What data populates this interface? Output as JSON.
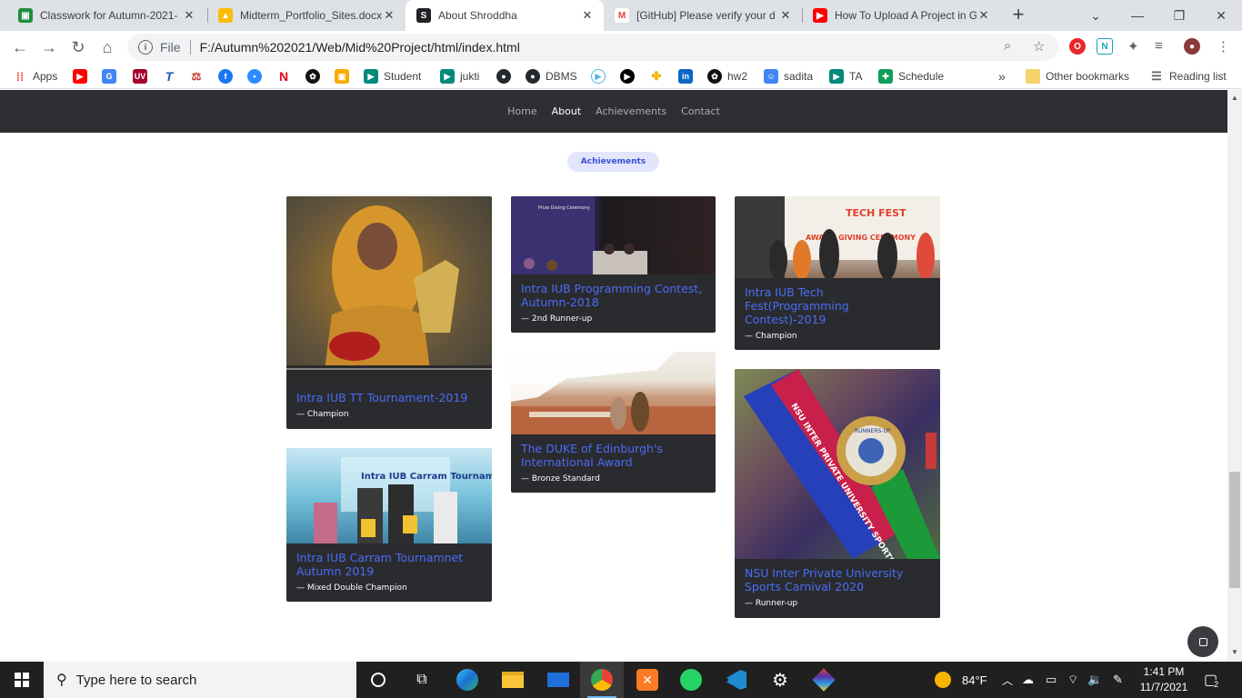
{
  "browser": {
    "tabs": [
      {
        "title": "Classwork for Autumn-2021-",
        "icon_color": "#1e8e3e",
        "icon": "classroom-icon"
      },
      {
        "title": "Midterm_Portfolio_Sites.docx",
        "icon_color": "#fbbc04",
        "icon": "google-drive-icon"
      },
      {
        "title": "About Shroddha",
        "icon_color": "#202124",
        "icon": "site-s-icon",
        "active": true
      },
      {
        "title": "[GitHub] Please verify your d",
        "icon_color": "#ea4335",
        "icon": "gmail-icon"
      },
      {
        "title": "How To Upload A Project in G",
        "icon_color": "#ff0000",
        "icon": "youtube-icon"
      }
    ],
    "new_tab_label": "+",
    "address": {
      "scheme_label": "File",
      "url": "F:/Autumn%202021/Web/Mid%20Project/html/index.html"
    },
    "bookmarks": [
      {
        "label": "Apps",
        "icon": "apps-grid-icon"
      },
      {
        "label": "",
        "icon": "youtube-icon"
      },
      {
        "label": "",
        "icon": "translate-icon"
      },
      {
        "label": "",
        "icon": "uva-icon"
      },
      {
        "label": "",
        "icon": "toph-icon"
      },
      {
        "label": "",
        "icon": "scale-icon"
      },
      {
        "label": "",
        "icon": "facebook-icon"
      },
      {
        "label": "",
        "icon": "zoom-icon"
      },
      {
        "label": "",
        "icon": "netflix-icon"
      },
      {
        "label": "",
        "icon": "openai-icon"
      },
      {
        "label": "",
        "icon": "classroom-icon"
      },
      {
        "label": "Student",
        "icon": "meet-icon"
      },
      {
        "label": "jukti",
        "icon": "meet-icon"
      },
      {
        "label": "",
        "icon": "github-icon"
      },
      {
        "label": "DBMS",
        "icon": "github-icon"
      },
      {
        "label": "",
        "icon": "circle-play-icon"
      },
      {
        "label": "",
        "icon": "play-icon"
      },
      {
        "label": "",
        "icon": "pinwheel-icon"
      },
      {
        "label": "",
        "icon": "linkedin-icon"
      },
      {
        "label": "hw2",
        "icon": "openai-icon"
      },
      {
        "label": "sadita",
        "icon": "contact-icon"
      },
      {
        "label": "TA",
        "icon": "meet-icon"
      },
      {
        "label": "Schedule",
        "icon": "sheets-icon"
      }
    ],
    "more_bookmarks": "»",
    "other_bookmarks": "Other bookmarks",
    "reading_list": "Reading list"
  },
  "site": {
    "nav": [
      "Home",
      "About",
      "Achievements",
      "Contact"
    ],
    "active_nav": "About",
    "section_pill": "Achievements",
    "cards": [
      {
        "title": "Intra IUB TT Tournament-2019",
        "subtitle": "— Champion"
      },
      {
        "title": "Intra IUB Carram Tournamnet Autumn 2019",
        "subtitle": "— Mixed Double Champion"
      },
      {
        "title": "Intra IUB Programming Contest, Autumn-2018",
        "subtitle": "— 2nd Runner-up"
      },
      {
        "title": "The DUKE of Edinburgh's International Award",
        "subtitle": "— Bronze Standard"
      },
      {
        "title": "Intra IUB Tech Fest(Programming Contest)-2019",
        "subtitle": "— Champion"
      },
      {
        "title": "NSU Inter Private University Sports Carnival 2020",
        "subtitle": "— Runner-up"
      }
    ],
    "image_text": {
      "carram_banner": "Intra IUB Carram Tournament",
      "techfest_banner": "TECH FEST",
      "techfest_sub": "AWARD GIVING CEREMONY",
      "prog_banner": "Prize Giving Ceremony",
      "medal_ribbon": "NSU INTER PRIVATE UNIVERSITY SPORTS CARNIVAL 2020",
      "medal_text": "RUNNERS-UP"
    }
  },
  "taskbar": {
    "search_placeholder": "Type here to search",
    "weather": "84°F",
    "time": "1:41 PM",
    "date": "11/7/2021",
    "notification_count": "2"
  }
}
